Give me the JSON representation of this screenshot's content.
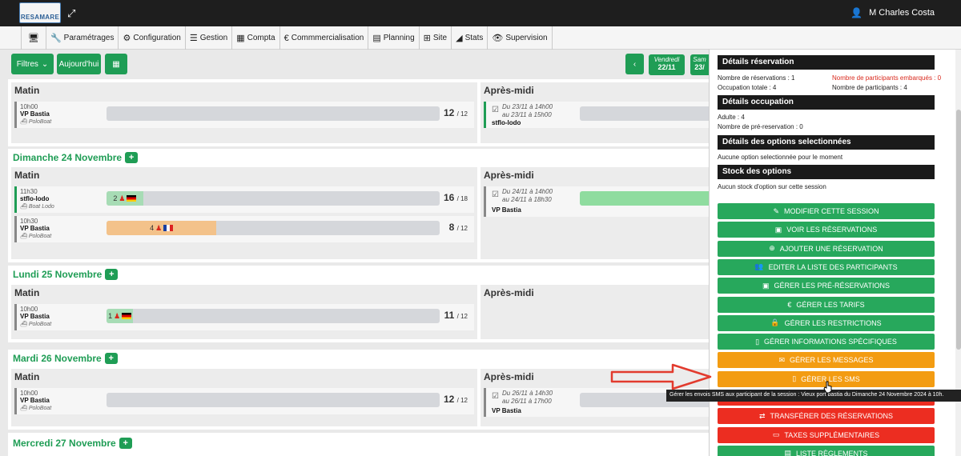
{
  "header": {
    "logo_text": "RESAMARE",
    "user_name": "M Charles Costa"
  },
  "menu": [
    {
      "icon": "monitor-icon",
      "glyph": "🖥",
      "label": ""
    },
    {
      "icon": "wrench-icon",
      "glyph": "🔧",
      "label": "Paramétrages"
    },
    {
      "icon": "cogs-icon",
      "glyph": "⚙",
      "label": "Configuration"
    },
    {
      "icon": "list-icon",
      "glyph": "☰",
      "label": "Gestion"
    },
    {
      "icon": "calculator-icon",
      "glyph": "▦",
      "label": "Compta"
    },
    {
      "icon": "euro-icon",
      "glyph": "€",
      "label": "Commmercialisation"
    },
    {
      "icon": "calendar-icon",
      "glyph": "▤",
      "label": "Planning"
    },
    {
      "icon": "sitemap-icon",
      "glyph": "⊞",
      "label": "Site"
    },
    {
      "icon": "area-chart-icon",
      "glyph": "◢",
      "label": "Stats"
    },
    {
      "icon": "eye-icon",
      "glyph": "👁",
      "label": "Supervision"
    }
  ],
  "toolbar": {
    "filters_label": "Filtres",
    "today_label": "Aujourd'hui",
    "date_prev_day": "Vendredi",
    "date_prev_num": "22/11",
    "date_next_day": "Sam",
    "date_next_num": "23/"
  },
  "days": {
    "d0": {
      "matin": {
        "title": "Matin",
        "time": "10h00",
        "name": "VP Bastia",
        "boat": "PoloBoat",
        "count": "12",
        "cap": "12"
      },
      "aprem": {
        "title": "Après-midi",
        "when1": "Du 23/11 à 14h00",
        "when2": "au 23/11 à 15h00",
        "name": "stflo-lodo"
      }
    },
    "d1": {
      "title": "Dimanche 24 Novembre",
      "matin": {
        "title": "Matin",
        "slot1": {
          "time": "11h30",
          "name": "stflo-lodo",
          "boat": "Boat Lodo",
          "fill_label": "2",
          "count": "16",
          "cap": "18",
          "fill_ratio": 0.11
        },
        "slot2": {
          "time": "10h30",
          "name": "VP Bastia",
          "boat": "PoloBoat",
          "fill_label": "4",
          "count": "8",
          "cap": "12",
          "fill_ratio": 0.33
        }
      },
      "aprem": {
        "title": "Après-midi",
        "when1": "Du 24/11 à 14h00",
        "when2": "au 24/11 à 18h30",
        "name": "VP Bastia"
      }
    },
    "d2": {
      "title": "Lundi 25 Novembre",
      "matin": {
        "title": "Matin",
        "time": "10h00",
        "name": "VP Bastia",
        "boat": "PoloBoat",
        "fill_label": "1",
        "count": "11",
        "cap": "12",
        "fill_ratio": 0.08
      },
      "aprem": {
        "title": "Après-midi"
      }
    },
    "d3": {
      "title": "Mardi 26 Novembre",
      "matin": {
        "title": "Matin",
        "time": "10h00",
        "name": "VP Bastia",
        "boat": "PoloBoat",
        "count": "12",
        "cap": "12"
      },
      "aprem": {
        "title": "Après-midi",
        "when1": "Du 26/11 à 14h30",
        "when2": "au 26/11 à 17h00",
        "name": "VP Bastia"
      }
    },
    "d4": {
      "title": "Mercredi 27 Novembre"
    }
  },
  "panel": {
    "details_reservation": "Détails réservation",
    "nb_reservations": "Nombre de réservations : 1",
    "nb_embarques": "Nombre de participants embarqués : 0",
    "occupation": "Occupation totale : 4",
    "nb_participants": "Nombre de participants : 4",
    "details_occupation": "Détails occupation",
    "adulte": "Adulte : 4",
    "pre_reservation": "Nombre de pré-reservation : 0",
    "details_options": "Détails des options selectionnées",
    "no_option": "Aucune option selectionnée pour le moment",
    "stock_options": "Stock des options",
    "no_stock": "Aucun stock d'option sur cette session",
    "buttons": [
      {
        "label": "Modifier cette session",
        "icon": "✎",
        "color": "g"
      },
      {
        "label": "Voir les réservations",
        "icon": "▣",
        "color": "g"
      },
      {
        "label": "Ajouter une réservation",
        "icon": "⊕",
        "color": "g"
      },
      {
        "label": "Editer la liste des participants",
        "icon": "👥",
        "color": "g"
      },
      {
        "label": "Gérer les pré-réservations",
        "icon": "▣",
        "color": "g"
      },
      {
        "label": "Gérer les tarifs",
        "icon": "€",
        "color": "g"
      },
      {
        "label": "Gérer les restrictions",
        "icon": "🔒",
        "color": "g"
      },
      {
        "label": "Gérer informations spécifiques",
        "icon": "▯",
        "color": "g"
      },
      {
        "label": "Gérer les messages",
        "icon": "✉",
        "color": "o"
      },
      {
        "label": "Gérer les SMS",
        "icon": "▯",
        "color": "o"
      },
      {
        "label": "",
        "icon": "",
        "color": "r"
      },
      {
        "label": "Transférer des réservations",
        "icon": "⇄",
        "color": "r"
      },
      {
        "label": "Taxes supplémentaires",
        "icon": "▭",
        "color": "r"
      },
      {
        "label": "Liste règlements",
        "icon": "▤",
        "color": "g"
      }
    ]
  },
  "tooltip": "Gérer les envois SMS aux participant de la session : Vieux port bastia du Dimanche 24 Novembre 2024 à 10h."
}
